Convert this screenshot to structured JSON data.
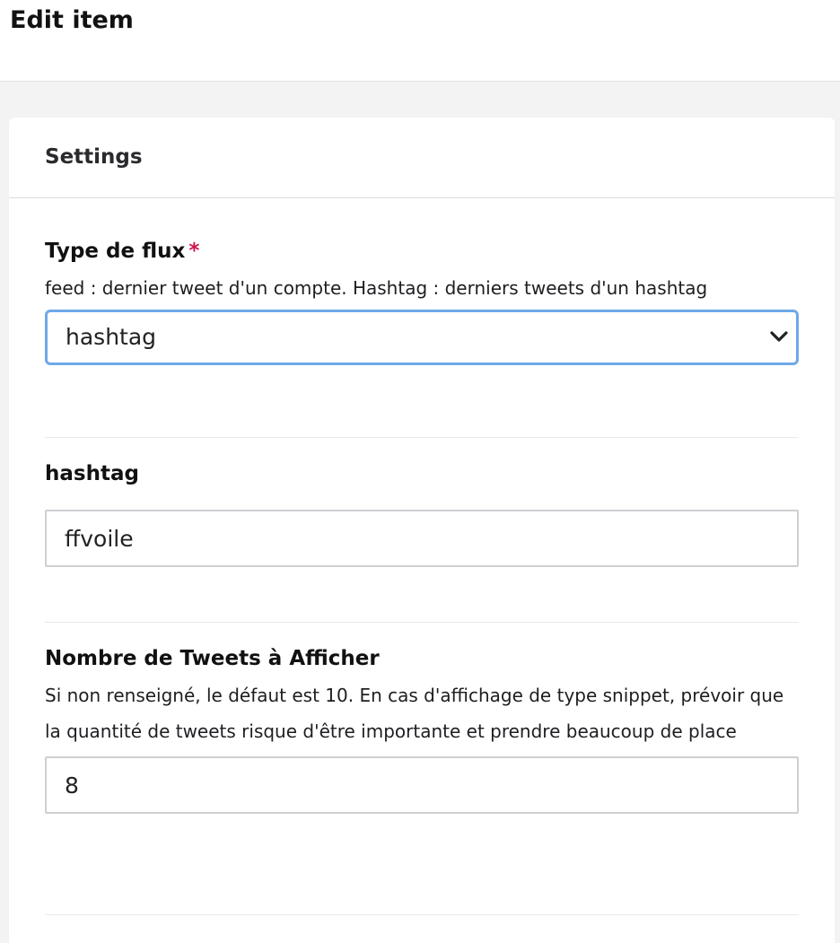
{
  "page": {
    "title": "Edit item"
  },
  "card": {
    "title": "Settings"
  },
  "fields": {
    "feed_type": {
      "label": "Type de flux",
      "required_mark": "*",
      "description": "feed : dernier tweet d'un compte. Hashtag : derniers tweets d'un hashtag",
      "selected_value": "hashtag",
      "icon": "chevron-down-icon"
    },
    "hashtag": {
      "label": "hashtag",
      "value": "ffvoile"
    },
    "tweet_count": {
      "label": "Nombre de Tweets à Afficher",
      "description": "Si non renseigné, le défaut est 10. En cas d'affichage de type snippet, prévoir que la quantité de tweets risque d'être importante et prendre beaucoup de place",
      "value": "8"
    }
  },
  "colors": {
    "required": "#d0154b",
    "focus_border": "#6ea8e8",
    "background": "#f3f3f4"
  }
}
